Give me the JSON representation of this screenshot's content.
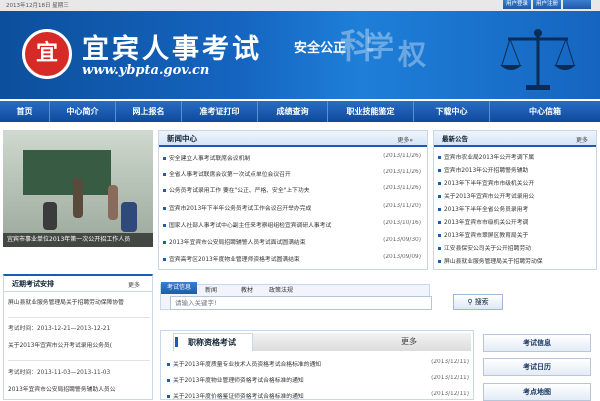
{
  "topbar": {
    "date": "2013年12月18日 星期三",
    "buttons": [
      "用户登录",
      "用户注册",
      ""
    ]
  },
  "header": {
    "logo_char": "宜",
    "site_name": "宜宾人事考试",
    "site_url": "www.ybpta.gov.cn",
    "slogan": "安全公正",
    "deco_chars": [
      "科",
      "学",
      "权"
    ]
  },
  "nav": {
    "items": [
      "首页",
      "中心简介",
      "网上报名",
      "准考证打印",
      "成绩查询",
      "职业技能鉴定",
      "下载中心",
      "中心信箱"
    ]
  },
  "photo": {
    "caption": "宜宾市事业单位2013年第一次公开招工作人员"
  },
  "news_center": {
    "title": "新闻中心",
    "more": "更多»",
    "items": [
      {
        "text": "安全建立人事考试联席会议机制",
        "date": "(2013/11/26)"
      },
      {
        "text": "全省人事考试联席会议第一次试点单位会议召开",
        "date": "(2013/11/26)"
      },
      {
        "text": "公务员考试录用工作 要在\"公正、严格、安全\"上下功夫",
        "date": "(2013/11/26)"
      },
      {
        "text": "宜宾市2013年下半年公务员考试工作会议召开举办完成",
        "date": "(2013/11/20)"
      },
      {
        "text": "国家人社部人事考试中心副主任来考察组组检宜宾调研人事考试",
        "date": "(2013/10/16)"
      },
      {
        "text": "2013年宜宾市公安局招聘辅警人员考试面试圆满结束",
        "date": "(2013/09/30)"
      },
      {
        "text": "宜宾高考区2013年度物业管理师资格考试圆满结束",
        "date": "(2013/09/09)"
      }
    ]
  },
  "notices": {
    "title": "最新公告",
    "more": "更多",
    "items": [
      "宜宾市农业局2013年公开考调下属",
      "宜宾市2013年公开招聘警务辅助",
      "2013年下半年宜宾市市级机关公开",
      "关于2013年宜宾市公开考试录用公",
      "2013年下半年全省公务员录用考",
      "2013年宜宾市市级机关公开考调",
      "2013年宜宾市翠屏区教育局关于",
      "江安县保安公司关于公开招聘劳动",
      "屏山县就业服务管理局关于招聘劳动保"
    ]
  },
  "exam_schedule": {
    "title": "近期考试安排",
    "more": "更多",
    "lines": [
      "屏山县就业服务管理局关于招聘劳动保障协管",
      "考试时间：2013-12-21—2013-12-21",
      "关于2013年宜宾市公开考试录用公务员(",
      "考试时间：2013-11-03—2013-11-03",
      "2013年宜宾市公安局招聘警务辅助人员公"
    ]
  },
  "search": {
    "tabs": [
      "考试信息",
      "新闻",
      "教材",
      "政策法规"
    ],
    "placeholder": "请输入关键字!",
    "button": "搜索"
  },
  "qualification": {
    "title": "职称资格考试",
    "more": "更多",
    "items": [
      {
        "text": "关于2013年度质量专业技术人员资格考试合格标准的通知",
        "date": "(2013/12/11)"
      },
      {
        "text": "关于2013年度物业管理师资格考试合格标准的通知",
        "date": "(2013/12/11)"
      },
      {
        "text": "关于2013年度价格鉴证师资格考试合格标准的通知",
        "date": "(2013/12/11)"
      }
    ]
  },
  "quick_links": [
    "考试信息",
    "考试日历",
    "考点地图"
  ]
}
